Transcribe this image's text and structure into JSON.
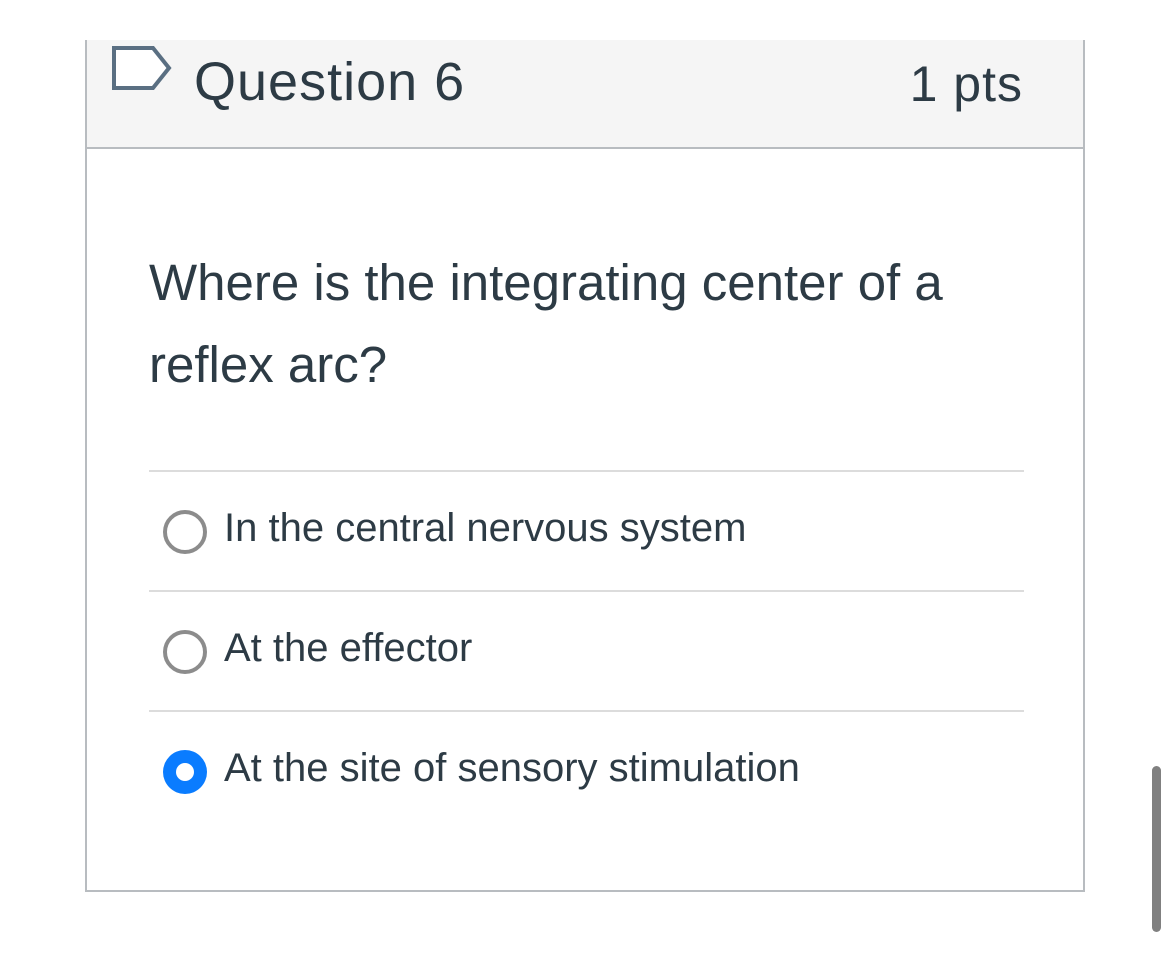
{
  "question": {
    "title": "Question 6",
    "points": "1 pts",
    "text": "Where is the integrating center of a reflex arc?",
    "flag_icon": "flag-outline-icon"
  },
  "answers": [
    {
      "label": "In the central nervous system",
      "selected": false
    },
    {
      "label": "At the effector",
      "selected": false
    },
    {
      "label": "At the site of sensory stimulation",
      "selected": true
    }
  ],
  "colors": {
    "selected_radio": "#0a7cff",
    "unselected_radio_border": "#8c8c8c",
    "text": "#2d3b45",
    "header_background": "#f5f5f5"
  }
}
